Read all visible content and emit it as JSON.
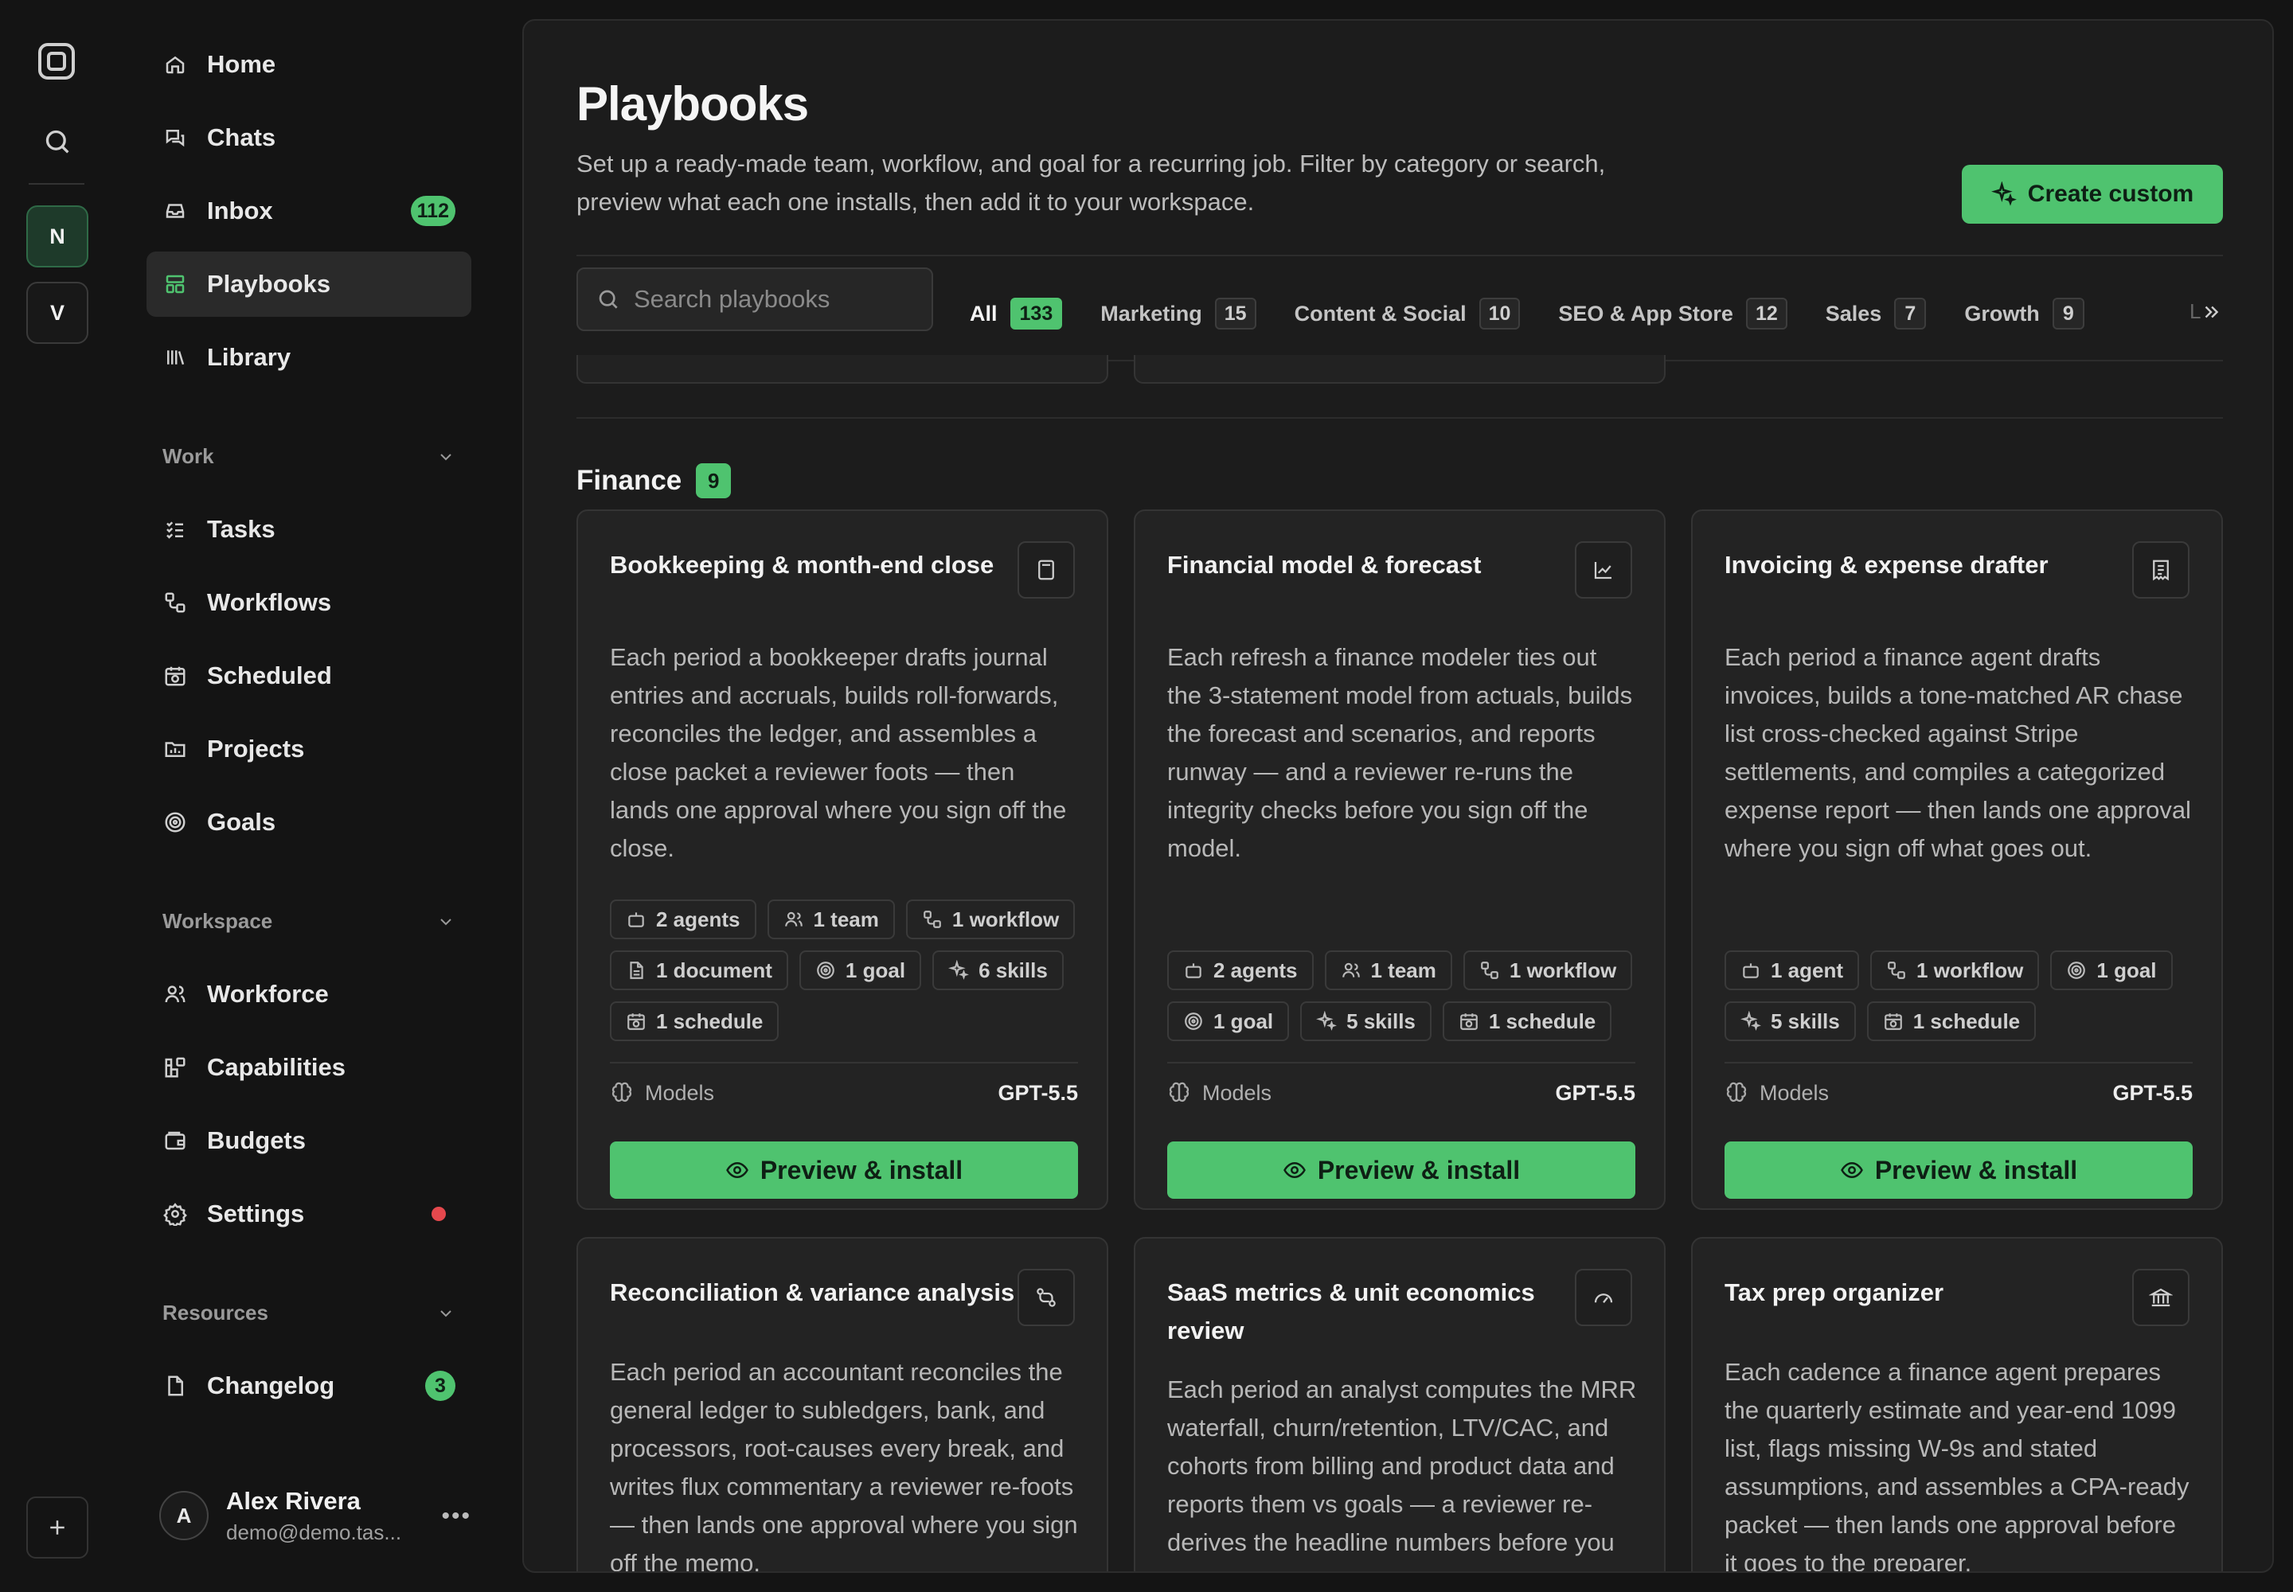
{
  "rail": {
    "workspaces": [
      {
        "initial": "N",
        "active": true
      },
      {
        "initial": "V",
        "active": false
      }
    ]
  },
  "sidebar": {
    "nav": [
      {
        "label": "Home",
        "icon": "home-icon"
      },
      {
        "label": "Chats",
        "icon": "chats-icon"
      },
      {
        "label": "Inbox",
        "icon": "inbox-icon",
        "count": "112"
      },
      {
        "label": "Playbooks",
        "icon": "playbooks-icon",
        "active": true
      },
      {
        "label": "Library",
        "icon": "library-icon"
      }
    ],
    "sections": [
      {
        "title": "Work",
        "items": [
          {
            "label": "Tasks",
            "icon": "tasks-icon"
          },
          {
            "label": "Workflows",
            "icon": "workflows-icon"
          },
          {
            "label": "Scheduled",
            "icon": "scheduled-icon"
          },
          {
            "label": "Projects",
            "icon": "projects-icon"
          },
          {
            "label": "Goals",
            "icon": "goals-icon"
          }
        ]
      },
      {
        "title": "Workspace",
        "items": [
          {
            "label": "Workforce",
            "icon": "workforce-icon"
          },
          {
            "label": "Capabilities",
            "icon": "capabilities-icon"
          },
          {
            "label": "Budgets",
            "icon": "budgets-icon"
          },
          {
            "label": "Settings",
            "icon": "settings-icon",
            "dot": true
          }
        ]
      },
      {
        "title": "Resources",
        "items": [
          {
            "label": "Changelog",
            "icon": "changelog-icon",
            "count": "3"
          }
        ]
      }
    ],
    "user": {
      "initial": "A",
      "name": "Alex Rivera",
      "email": "demo@demo.tas..."
    }
  },
  "main": {
    "title": "Playbooks",
    "description": "Set up a ready-made team, workflow, and goal for a recurring job. Filter by category or search, preview what each one installs, then add it to your workspace.",
    "create_label": "Create custom",
    "search_placeholder": "Search playbooks",
    "tabs": [
      {
        "label": "All",
        "count": "133",
        "active": true
      },
      {
        "label": "Marketing",
        "count": "15"
      },
      {
        "label": "Content & Social",
        "count": "10"
      },
      {
        "label": "SEO & App Store",
        "count": "12"
      },
      {
        "label": "Sales",
        "count": "7"
      },
      {
        "label": "Growth",
        "count": "9"
      }
    ],
    "tabs_overflow": "L",
    "category": {
      "name": "Finance",
      "count": "9"
    },
    "models_label": "Models",
    "install_label": "Preview & install",
    "cards": [
      {
        "title": "Bookkeeping & month-end close",
        "icon": "calculator-icon",
        "description": "Each period a bookkeeper drafts journal entries and accruals, builds roll-forwards, reconciles the ledger, and assembles a close packet a reviewer foots — then lands one approval where you sign off the close.",
        "chips": [
          {
            "icon": "agent-icon",
            "label": "2 agents"
          },
          {
            "icon": "team-icon",
            "label": "1 team"
          },
          {
            "icon": "workflow-icon",
            "label": "1 workflow"
          },
          {
            "icon": "document-icon",
            "label": "1 document"
          },
          {
            "icon": "goal-icon",
            "label": "1 goal"
          },
          {
            "icon": "skills-icon",
            "label": "6 skills"
          },
          {
            "icon": "schedule-icon",
            "label": "1 schedule"
          }
        ],
        "model": "GPT-5.5"
      },
      {
        "title": "Financial model & forecast",
        "icon": "line-chart-icon",
        "description": "Each refresh a finance modeler ties out the 3-statement model from actuals, builds the forecast and scenarios, and reports runway — and a reviewer re-runs the integrity checks before you sign off the model.",
        "chips": [
          {
            "icon": "agent-icon",
            "label": "2 agents"
          },
          {
            "icon": "team-icon",
            "label": "1 team"
          },
          {
            "icon": "workflow-icon",
            "label": "1 workflow"
          },
          {
            "icon": "goal-icon",
            "label": "1 goal"
          },
          {
            "icon": "skills-icon",
            "label": "5 skills"
          },
          {
            "icon": "schedule-icon",
            "label": "1 schedule"
          }
        ],
        "model": "GPT-5.5"
      },
      {
        "title": "Invoicing & expense drafter",
        "icon": "receipt-icon",
        "description": "Each period a finance agent drafts invoices, builds a tone-matched AR chase list cross-checked against Stripe settlements, and compiles a categorized expense report — then lands one approval where you sign off what goes out.",
        "chips": [
          {
            "icon": "agent-icon",
            "label": "1 agent"
          },
          {
            "icon": "workflow-icon",
            "label": "1 workflow"
          },
          {
            "icon": "goal-icon",
            "label": "1 goal"
          },
          {
            "icon": "skills-icon",
            "label": "5 skills"
          },
          {
            "icon": "schedule-icon",
            "label": "1 schedule"
          }
        ],
        "model": "GPT-5.5"
      },
      {
        "title": "Reconciliation & variance analysis",
        "icon": "git-compare-icon",
        "description": "Each period an accountant reconciles the general ledger to subledgers, bank, and processors, root-causes every break, and writes flux commentary a reviewer re-foots — then lands one approval where you sign off the memo."
      },
      {
        "title": "SaaS metrics & unit economics review",
        "icon": "gauge-icon",
        "description": "Each period an analyst computes the MRR waterfall, churn/retention, LTV/CAC, and cohorts from billing and product data and reports them vs goals — a reviewer re-derives the headline numbers before you sign off."
      },
      {
        "title": "Tax prep organizer",
        "icon": "bank-icon",
        "description": "Each cadence a finance agent prepares the quarterly estimate and year-end 1099 list, flags missing W-9s and stated assumptions, and assembles a CPA-ready packet — then lands one approval before it goes to the preparer."
      }
    ]
  }
}
